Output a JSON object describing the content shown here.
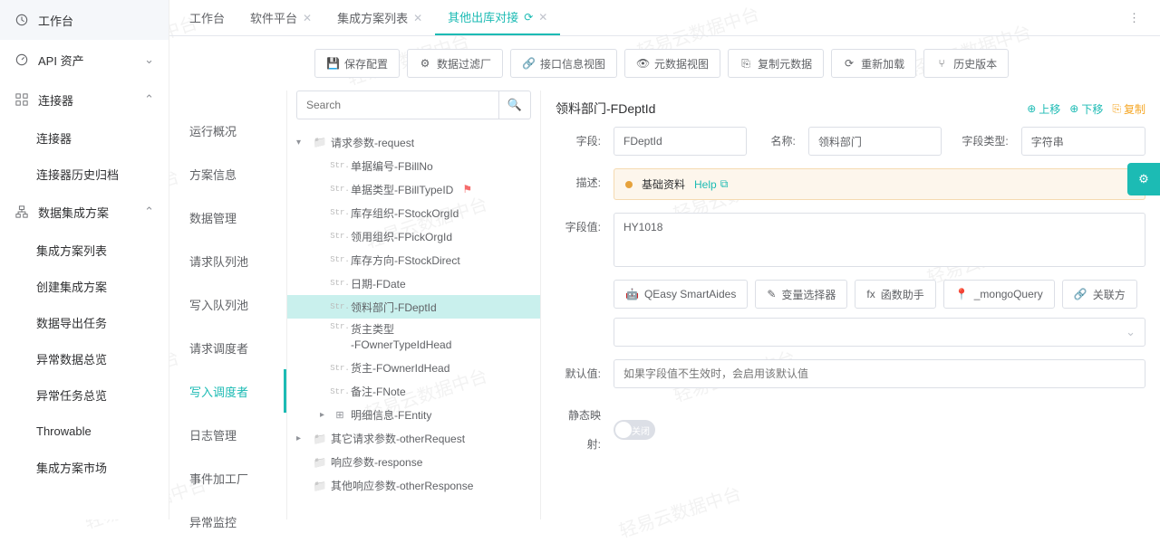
{
  "watermark": "轻易云数据中台",
  "sidebar_left": [
    {
      "icon": "clock",
      "label": "工作台",
      "expandable": false
    },
    {
      "icon": "api",
      "label": "API 资产",
      "expandable": true,
      "collapsed": true
    },
    {
      "icon": "connector",
      "label": "连接器",
      "expandable": true,
      "collapsed": false,
      "children": [
        {
          "label": "连接器"
        },
        {
          "label": "连接器历史归档"
        }
      ]
    },
    {
      "icon": "integration",
      "label": "数据集成方案",
      "expandable": true,
      "collapsed": false,
      "children": [
        {
          "label": "集成方案列表"
        },
        {
          "label": "创建集成方案"
        },
        {
          "label": "数据导出任务"
        },
        {
          "label": "异常数据总览"
        },
        {
          "label": "异常任务总览"
        },
        {
          "label": "Throwable"
        },
        {
          "label": "集成方案市场"
        }
      ]
    }
  ],
  "tabs": [
    {
      "label": "工作台",
      "closable": false,
      "active": false
    },
    {
      "label": "软件平台",
      "closable": true,
      "active": false
    },
    {
      "label": "集成方案列表",
      "closable": true,
      "active": false
    },
    {
      "label": "其他出库对接",
      "closable": true,
      "active": true,
      "refresh": true
    }
  ],
  "sidebar2": [
    {
      "label": "运行概况"
    },
    {
      "label": "方案信息"
    },
    {
      "label": "数据管理"
    },
    {
      "label": "请求队列池"
    },
    {
      "label": "写入队列池"
    },
    {
      "label": "请求调度者"
    },
    {
      "label": "写入调度者",
      "active": true
    },
    {
      "label": "日志管理"
    },
    {
      "label": "事件加工厂"
    },
    {
      "label": "异常监控"
    }
  ],
  "toolbar_buttons": [
    {
      "icon": "save",
      "label": "保存配置"
    },
    {
      "icon": "filter",
      "label": "数据过滤厂"
    },
    {
      "icon": "link",
      "label": "接口信息视图"
    },
    {
      "icon": "eye",
      "label": "元数据视图"
    },
    {
      "icon": "copy",
      "label": "复制元数据"
    },
    {
      "icon": "reload",
      "label": "重新加载"
    },
    {
      "icon": "history",
      "label": "历史版本"
    }
  ],
  "search_placeholder": "Search",
  "tree": [
    {
      "type": "folder",
      "label": "请求参数-request",
      "expanded": true,
      "lvl": 1,
      "caret": true,
      "children": [
        {
          "type": "str",
          "label": "单据编号-FBillNo",
          "lvl": 2
        },
        {
          "type": "str",
          "label": "单据类型-FBillTypeID",
          "lvl": 2,
          "flag": true
        },
        {
          "type": "str",
          "label": "库存组织-FStockOrgId",
          "lvl": 2
        },
        {
          "type": "str",
          "label": "领用组织-FPickOrgId",
          "lvl": 2
        },
        {
          "type": "str",
          "label": "库存方向-FStockDirect",
          "lvl": 2
        },
        {
          "type": "str",
          "label": "日期-FDate",
          "lvl": 2
        },
        {
          "type": "str",
          "label": "领料部门-FDeptId",
          "lvl": 2,
          "selected": true
        },
        {
          "type": "str",
          "label": "货主类型-FOwnerTypeIdHead",
          "lvl": 2,
          "multiline": true
        },
        {
          "type": "str",
          "label": "货主-FOwnerIdHead",
          "lvl": 2
        },
        {
          "type": "str",
          "label": "备注-FNote",
          "lvl": 2
        },
        {
          "type": "grid",
          "label": "明细信息-FEntity",
          "lvl": 2,
          "caret": true
        }
      ]
    },
    {
      "type": "folder",
      "label": "其它请求参数-otherRequest",
      "lvl": 1,
      "caret": true
    },
    {
      "type": "folder",
      "label": "响应参数-response",
      "lvl": 1
    },
    {
      "type": "folder",
      "label": "其他响应参数-otherResponse",
      "lvl": 1
    }
  ],
  "detail": {
    "title": "领料部门-FDeptId",
    "actions": {
      "up": "上移",
      "down": "下移",
      "copy": "复制"
    },
    "field_label": "字段:",
    "field_value": "FDeptId",
    "name_label": "名称:",
    "name_value": "领料部门",
    "type_label": "字段类型:",
    "type_value": "字符串",
    "desc_label": "描述:",
    "desc_badge": "基础资料",
    "desc_help": "Help",
    "value_label": "字段值:",
    "value_value": "HY1018",
    "tool_buttons": [
      {
        "icon": "ai",
        "label": "QEasy SmartAides"
      },
      {
        "icon": "var",
        "label": "变量选择器"
      },
      {
        "icon": "fx",
        "label": "函数助手"
      },
      {
        "icon": "mongo",
        "label": "_mongoQuery"
      },
      {
        "icon": "rel",
        "label": "关联方"
      }
    ],
    "default_label": "默认值:",
    "default_placeholder": "如果字段值不生效时，会启用该默认值",
    "static_label": "静态映射:",
    "toggle_off": "关闭"
  }
}
